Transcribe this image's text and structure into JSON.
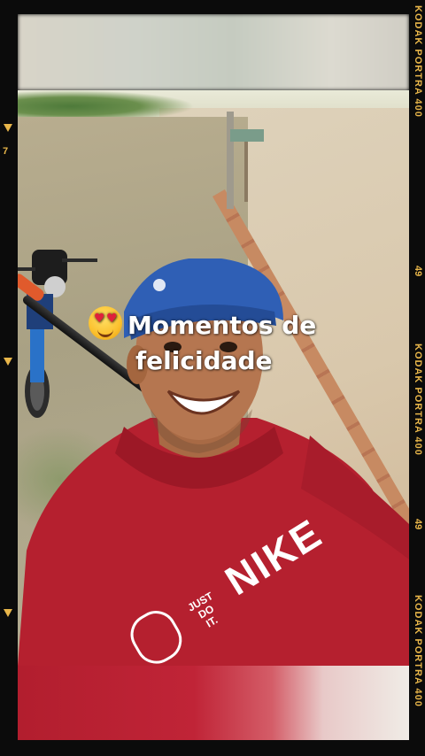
{
  "film_edge": {
    "brand_top": "KODAK PORTRA 400",
    "number_1": "49",
    "brand_middle": "KODAK PORTRA 400",
    "number_2": "49",
    "brand_bottom": "KODAK PORTRA 400",
    "left_mark": "7",
    "accent_color": "#e8b64a"
  },
  "caption": {
    "emoji": "heart-eyes-emoji",
    "line1": "Momentos de",
    "line2": "felicidade"
  },
  "shirt": {
    "brand_text": "NIKE",
    "badge_line1": "JUST",
    "badge_line2": "DO",
    "badge_line3": "IT."
  }
}
